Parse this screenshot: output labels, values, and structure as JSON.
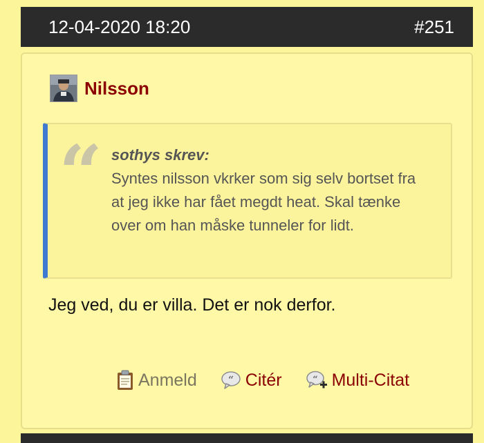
{
  "post": {
    "date": "12-04-2020 18:20",
    "number": "#251",
    "author": "Nilsson",
    "quote": {
      "author": "sothys skrev:",
      "text": "Syntes nilsson vkrker som sig selv bortset fra at jeg ikke har fået megdt heat. Skal tænke over om han måske tunneler for lidt."
    },
    "message": "Jeg ved, du er villa. Det er nok derfor.",
    "actions": {
      "report_label": "Anmeld",
      "quote_label": "Citér",
      "multiquote_label": "Multi-Citat"
    }
  },
  "colors": {
    "background": "#fdf59a",
    "header": "#2b2b2b",
    "author_name": "#8b0000",
    "quote_accent": "#3f7ad0"
  },
  "icons": {
    "report": "clipboard-icon",
    "quote": "speech-bubble-icon",
    "multiquote": "speech-bubble-plus-icon"
  }
}
